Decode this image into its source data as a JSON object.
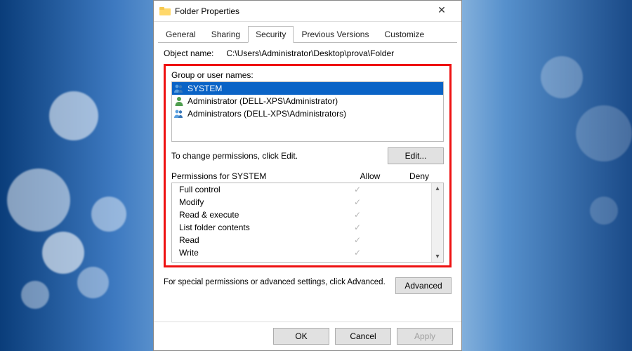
{
  "window": {
    "title": "Folder Properties"
  },
  "tabs": {
    "items": [
      "General",
      "Sharing",
      "Security",
      "Previous Versions",
      "Customize"
    ],
    "active": 2
  },
  "object": {
    "label": "Object name:",
    "path": "C:\\Users\\Administrator\\Desktop\\prova\\Folder"
  },
  "groups": {
    "label": "Group or user names:",
    "items": [
      {
        "icon": "group",
        "text": "SYSTEM",
        "selected": true
      },
      {
        "icon": "user",
        "text": "Administrator (DELL-XPS\\Administrator)",
        "selected": false
      },
      {
        "icon": "group",
        "text": "Administrators (DELL-XPS\\Administrators)",
        "selected": false
      }
    ]
  },
  "editHint": "To change permissions, click Edit.",
  "buttons": {
    "edit": "Edit...",
    "advanced": "Advanced",
    "ok": "OK",
    "cancel": "Cancel",
    "apply": "Apply"
  },
  "perm": {
    "headerFor": "Permissions for SYSTEM",
    "allow": "Allow",
    "deny": "Deny",
    "rows": [
      {
        "name": "Full control",
        "allow": true,
        "deny": false
      },
      {
        "name": "Modify",
        "allow": true,
        "deny": false
      },
      {
        "name": "Read & execute",
        "allow": true,
        "deny": false
      },
      {
        "name": "List folder contents",
        "allow": true,
        "deny": false
      },
      {
        "name": "Read",
        "allow": true,
        "deny": false
      },
      {
        "name": "Write",
        "allow": true,
        "deny": false
      }
    ]
  },
  "advText": "For special permissions or advanced settings, click Advanced."
}
